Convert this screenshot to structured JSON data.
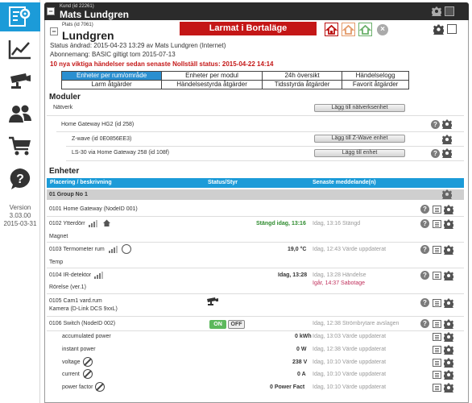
{
  "nav": {
    "version_label": "Version",
    "version": "3.03.00",
    "date": "2015-03-31",
    "items": [
      "settings-icon",
      "chart-icon",
      "camera-icon",
      "users-icon",
      "cart-icon",
      "help-icon"
    ]
  },
  "kund": {
    "label": "Kund (id 22261)",
    "name": "Mats Lundgren"
  },
  "plats": {
    "label": "Plats (id 7061)",
    "name": "Lundgren",
    "alarm_banner": "Larmat i Bortaläge",
    "status_changed": "Status ändrad: 2015-04-23 13:29 av Mats Lundgren (Internet)",
    "subscription": "Abonnemang: BASIC giltigt tom 2015-07-13",
    "events_notice": "10 nya viktiga händelser sedan senaste Nollställ status: 2015-04-22 14:14"
  },
  "tabs": {
    "row1": [
      "Enheter per rum/område",
      "Enheter per modul",
      "24h översikt",
      "Händelselogg"
    ],
    "row2": [
      "Larm åtgärder",
      "Händelsestyrda åtgärder",
      "Tidsstyrda åtgärder",
      "Favorit åtgärder"
    ]
  },
  "modules": {
    "title": "Moduler",
    "network_label": "Nätverk",
    "add_network_button": "Lägg till nätverksenhet",
    "gateway": "Home Gateway HG2 (id 258)",
    "zwave": "Z-wave (id 0E0856EE3)",
    "add_zwave_button": "Lägg till Z-Wave enhet",
    "ls30": "LS-30 via Home Gateway 258 (id 108f)",
    "add_unit_button": "Lägg till enhet"
  },
  "units": {
    "title": "Enheter",
    "col_location": "Placering / beskrivning",
    "col_status": "Status/Styr",
    "col_last_msg": "Senaste meddelande(n)",
    "group": "01 Group No 1",
    "rows": [
      {
        "name": "0101 Home Gateway (NodeID 001)"
      },
      {
        "name": "0102 Ytterdörr",
        "sub": "Magnet",
        "status": "Stängd idag, 13:16",
        "msg": "Idag, 13:16 Stängd"
      },
      {
        "name": "0103 Termometer rum",
        "sub": "Temp",
        "status": "19,0 °C",
        "msg": "Idag, 12:43 Värde uppdaterat"
      },
      {
        "name": "0104 IR-detektor",
        "sub": "Rörelse (ver.1)",
        "status": "Idag, 13:28",
        "msg": "Idag, 13:28 Händelse",
        "msg2": "Igår, 14:37 Sabotage"
      },
      {
        "name": "0105 Cam1 vard.rum",
        "sub": "Kamera (D-Link DCS 9xxL)"
      },
      {
        "name": "0106 Switch (NodeID 002)",
        "on_label": "ON",
        "off_label": "OFF",
        "msg": "Idag, 12:38 Strömbrytare avslagen"
      }
    ],
    "sub_rows": [
      {
        "name": "accumulated power",
        "value": "0 kWh",
        "msg": "Idag, 13:03 Värde uppdaterat"
      },
      {
        "name": "instant power",
        "value": "0 W",
        "msg": "Idag, 12:38 Värde uppdaterat"
      },
      {
        "name": "voltage",
        "value": "238 V",
        "msg": "Idag, 10:10 Värde uppdaterat"
      },
      {
        "name": "current",
        "value": "0 A",
        "msg": "Idag, 10:10 Värde uppdaterat"
      },
      {
        "name": "power factor",
        "value": "0 Power Fact",
        "msg": "Idag, 10:10 Värde uppdaterat"
      }
    ]
  },
  "colors": {
    "accent": "#1c9bd8",
    "alarm": "#c41717",
    "header": "#2b2b2b"
  }
}
